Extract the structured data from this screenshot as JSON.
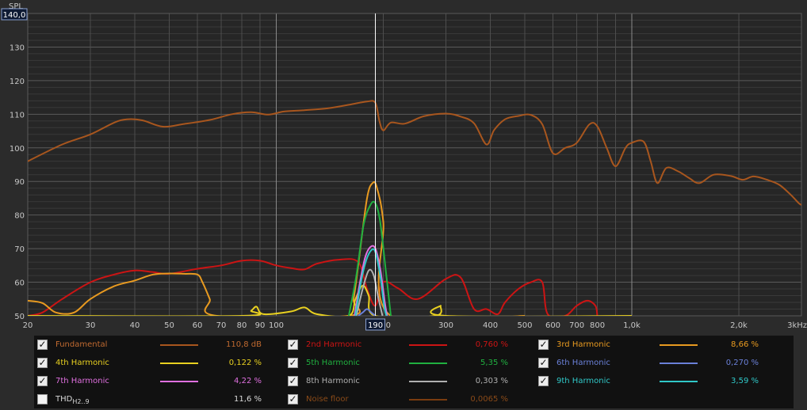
{
  "chart_data": {
    "type": "line",
    "title": "",
    "ylabel": "SPL",
    "xlabel": "",
    "xscale": "log",
    "xlim": [
      20,
      3000
    ],
    "ylim": [
      50,
      140
    ],
    "y_readout": "140,0",
    "cursor_x": 190,
    "cursor_label": "190",
    "grid": true,
    "yticks": [
      50,
      60,
      70,
      80,
      90,
      100,
      110,
      120,
      130
    ],
    "xticks": [
      {
        "v": 20,
        "label": "20"
      },
      {
        "v": 30,
        "label": "30"
      },
      {
        "v": 40,
        "label": "40"
      },
      {
        "v": 50,
        "label": "50"
      },
      {
        "v": 60,
        "label": "60"
      },
      {
        "v": 70,
        "label": "70"
      },
      {
        "v": 80,
        "label": "80"
      },
      {
        "v": 90,
        "label": "90"
      },
      {
        "v": 100,
        "label": "100"
      },
      {
        "v": 200,
        "label": "200"
      },
      {
        "v": 300,
        "label": "300"
      },
      {
        "v": 400,
        "label": "400"
      },
      {
        "v": 500,
        "label": "500"
      },
      {
        "v": 600,
        "label": "600"
      },
      {
        "v": 700,
        "label": "700"
      },
      {
        "v": 800,
        "label": "800"
      },
      {
        "v": 1000,
        "label": "1,0k"
      },
      {
        "v": 2000,
        "label": "2,0k"
      },
      {
        "v": 3000,
        "label": "3kHz"
      }
    ],
    "series": [
      {
        "name": "Fundamental",
        "color": "#a8561e",
        "points": [
          [
            20,
            96
          ],
          [
            25,
            101
          ],
          [
            30,
            104
          ],
          [
            35,
            107.5
          ],
          [
            38,
            108.5
          ],
          [
            42,
            108.2
          ],
          [
            48,
            106.3
          ],
          [
            55,
            107.1
          ],
          [
            65,
            108.3
          ],
          [
            75,
            110
          ],
          [
            85,
            110.6
          ],
          [
            95,
            109.9
          ],
          [
            105,
            110.8
          ],
          [
            120,
            111.2
          ],
          [
            140,
            111.8
          ],
          [
            160,
            112.8
          ],
          [
            180,
            113.8
          ],
          [
            190,
            113.4
          ],
          [
            195,
            108
          ],
          [
            200,
            105.2
          ],
          [
            210,
            107.5
          ],
          [
            230,
            107.2
          ],
          [
            260,
            109.4
          ],
          [
            300,
            110.2
          ],
          [
            330,
            109.3
          ],
          [
            360,
            107.3
          ],
          [
            390,
            101
          ],
          [
            410,
            105.3
          ],
          [
            440,
            108.5
          ],
          [
            480,
            109.5
          ],
          [
            520,
            109.8
          ],
          [
            560,
            107
          ],
          [
            600,
            98.4
          ],
          [
            650,
            100
          ],
          [
            700,
            101.5
          ],
          [
            760,
            107
          ],
          [
            800,
            106.4
          ],
          [
            850,
            100
          ],
          [
            900,
            94.5
          ],
          [
            960,
            100
          ],
          [
            1000,
            101.5
          ],
          [
            1080,
            101.8
          ],
          [
            1130,
            96
          ],
          [
            1180,
            89.5
          ],
          [
            1250,
            94
          ],
          [
            1350,
            93
          ],
          [
            1450,
            91
          ],
          [
            1550,
            89.5
          ],
          [
            1700,
            92
          ],
          [
            1900,
            91.6
          ],
          [
            2050,
            90.5
          ],
          [
            2200,
            91.5
          ],
          [
            2400,
            90.5
          ],
          [
            2600,
            89
          ],
          [
            2800,
            86
          ],
          [
            2950,
            83.5
          ],
          [
            3000,
            83
          ]
        ]
      },
      {
        "name": "2nd Harmonic",
        "color": "#cc1414",
        "points": [
          [
            20,
            50
          ],
          [
            22,
            51
          ],
          [
            25,
            55
          ],
          [
            30,
            60
          ],
          [
            35,
            62.3
          ],
          [
            40,
            63.5
          ],
          [
            45,
            63
          ],
          [
            50,
            62.5
          ],
          [
            60,
            64
          ],
          [
            70,
            65
          ],
          [
            80,
            66.4
          ],
          [
            90,
            66.4
          ],
          [
            100,
            65
          ],
          [
            110,
            64.2
          ],
          [
            120,
            63.8
          ],
          [
            130,
            65.5
          ],
          [
            150,
            66.7
          ],
          [
            170,
            66
          ],
          [
            180,
            58
          ],
          [
            190,
            53
          ],
          [
            200,
            60
          ],
          [
            220,
            58.2
          ],
          [
            250,
            55
          ],
          [
            300,
            61
          ],
          [
            330,
            61.4
          ],
          [
            360,
            52
          ],
          [
            390,
            52
          ],
          [
            420,
            50.5
          ],
          [
            440,
            54
          ],
          [
            480,
            58
          ],
          [
            520,
            60
          ],
          [
            560,
            60
          ],
          [
            580,
            50.5
          ],
          [
            650,
            50
          ],
          [
            700,
            53
          ],
          [
            750,
            54.5
          ],
          [
            790,
            53
          ],
          [
            800,
            50
          ]
        ]
      },
      {
        "name": "3rd Harmonic",
        "color": "#e89a20",
        "points": [
          [
            20,
            54.5
          ],
          [
            22,
            53.8
          ],
          [
            24,
            51
          ],
          [
            27,
            51
          ],
          [
            30,
            55
          ],
          [
            35,
            58.8
          ],
          [
            40,
            60.5
          ],
          [
            45,
            62.3
          ],
          [
            50,
            62.6
          ],
          [
            55,
            62.5
          ],
          [
            60,
            62.3
          ],
          [
            62,
            60
          ],
          [
            65,
            55
          ],
          [
            68,
            50
          ],
          [
            160,
            50
          ],
          [
            165,
            55
          ],
          [
            170,
            65
          ],
          [
            180,
            85
          ],
          [
            187,
            89.6
          ],
          [
            192,
            88
          ],
          [
            200,
            78
          ],
          [
            210,
            50
          ],
          [
            500,
            50
          ]
        ]
      },
      {
        "name": "4th Harmonic",
        "color": "#e8d020",
        "points": [
          [
            20,
            50
          ],
          [
            80,
            50
          ],
          [
            85,
            51.5
          ],
          [
            88,
            52.7
          ],
          [
            92,
            50.5
          ],
          [
            110,
            51.3
          ],
          [
            120,
            52.5
          ],
          [
            130,
            50.5
          ],
          [
            160,
            50
          ],
          [
            167,
            55
          ],
          [
            175,
            59
          ],
          [
            182,
            56
          ],
          [
            190,
            50
          ],
          [
            280,
            50
          ],
          [
            290,
            53
          ],
          [
            300,
            50
          ],
          [
            1000,
            50
          ]
        ]
      },
      {
        "name": "5th Harmonic",
        "color": "#20b040",
        "points": [
          [
            160,
            50
          ],
          [
            168,
            62
          ],
          [
            176,
            77
          ],
          [
            184,
            83
          ],
          [
            190,
            83.5
          ],
          [
            196,
            78
          ],
          [
            203,
            64
          ],
          [
            210,
            50
          ]
        ]
      },
      {
        "name": "6th Harmonic",
        "color": "#6a80d8",
        "points": [
          [
            170,
            50
          ],
          [
            175,
            51
          ],
          [
            180,
            52
          ],
          [
            185,
            51
          ],
          [
            190,
            50
          ]
        ]
      },
      {
        "name": "7th Harmonic",
        "color": "#e070e0",
        "points": [
          [
            166,
            50
          ],
          [
            172,
            60
          ],
          [
            178,
            67.5
          ],
          [
            184,
            70.5
          ],
          [
            190,
            70
          ],
          [
            196,
            64
          ],
          [
            202,
            54
          ],
          [
            205,
            50
          ]
        ]
      },
      {
        "name": "8th Harmonic",
        "color": "#b0b0b0",
        "points": [
          [
            168,
            50
          ],
          [
            175,
            58
          ],
          [
            182,
            63.5
          ],
          [
            188,
            62
          ],
          [
            194,
            55
          ],
          [
            199,
            50
          ]
        ]
      },
      {
        "name": "9th Harmonic",
        "color": "#30c8c8",
        "points": [
          [
            167,
            50
          ],
          [
            173,
            60
          ],
          [
            179,
            66.5
          ],
          [
            185,
            69.5
          ],
          [
            190,
            69
          ],
          [
            196,
            62
          ],
          [
            201,
            53
          ],
          [
            204,
            50
          ]
        ]
      }
    ]
  },
  "legend": {
    "items": [
      {
        "name": "Fundamental",
        "value": "110,8 dB",
        "color": "#a8561e",
        "checked": true,
        "dim": true
      },
      {
        "name": "2nd Harmonic",
        "value": "0,760 %",
        "color": "#cc1414",
        "checked": true,
        "dim": false
      },
      {
        "name": "3rd Harmonic",
        "value": "8,66 %",
        "color": "#e89a20",
        "checked": true,
        "dim": false
      },
      {
        "name": "4th Harmonic",
        "value": "0,122 %",
        "color": "#e8d020",
        "checked": true,
        "dim": false
      },
      {
        "name": "5th Harmonic",
        "value": "5,35 %",
        "color": "#20b040",
        "checked": true,
        "dim": false
      },
      {
        "name": "6th Harmonic",
        "value": "0,270 %",
        "color": "#6a80d8",
        "checked": true,
        "dim": false
      },
      {
        "name": "7th Harmonic",
        "value": "4,22 %",
        "color": "#e070e0",
        "checked": true,
        "dim": false
      },
      {
        "name": "8th Harmonic",
        "value": "0,303 %",
        "color": "#b0b0b0",
        "checked": true,
        "dim": false
      },
      {
        "name": "9th Harmonic",
        "value": "3,59 %",
        "color": "#30c8c8",
        "checked": true,
        "dim": false
      },
      {
        "name": "THD",
        "sub": "H2..9",
        "value": "11,6 %",
        "color": "#d8d8d8",
        "checked": false,
        "dim": false
      },
      {
        "name": "Noise floor",
        "value": "0,0065 %",
        "color": "#7a3c10",
        "checked": true,
        "dim": true
      }
    ]
  }
}
